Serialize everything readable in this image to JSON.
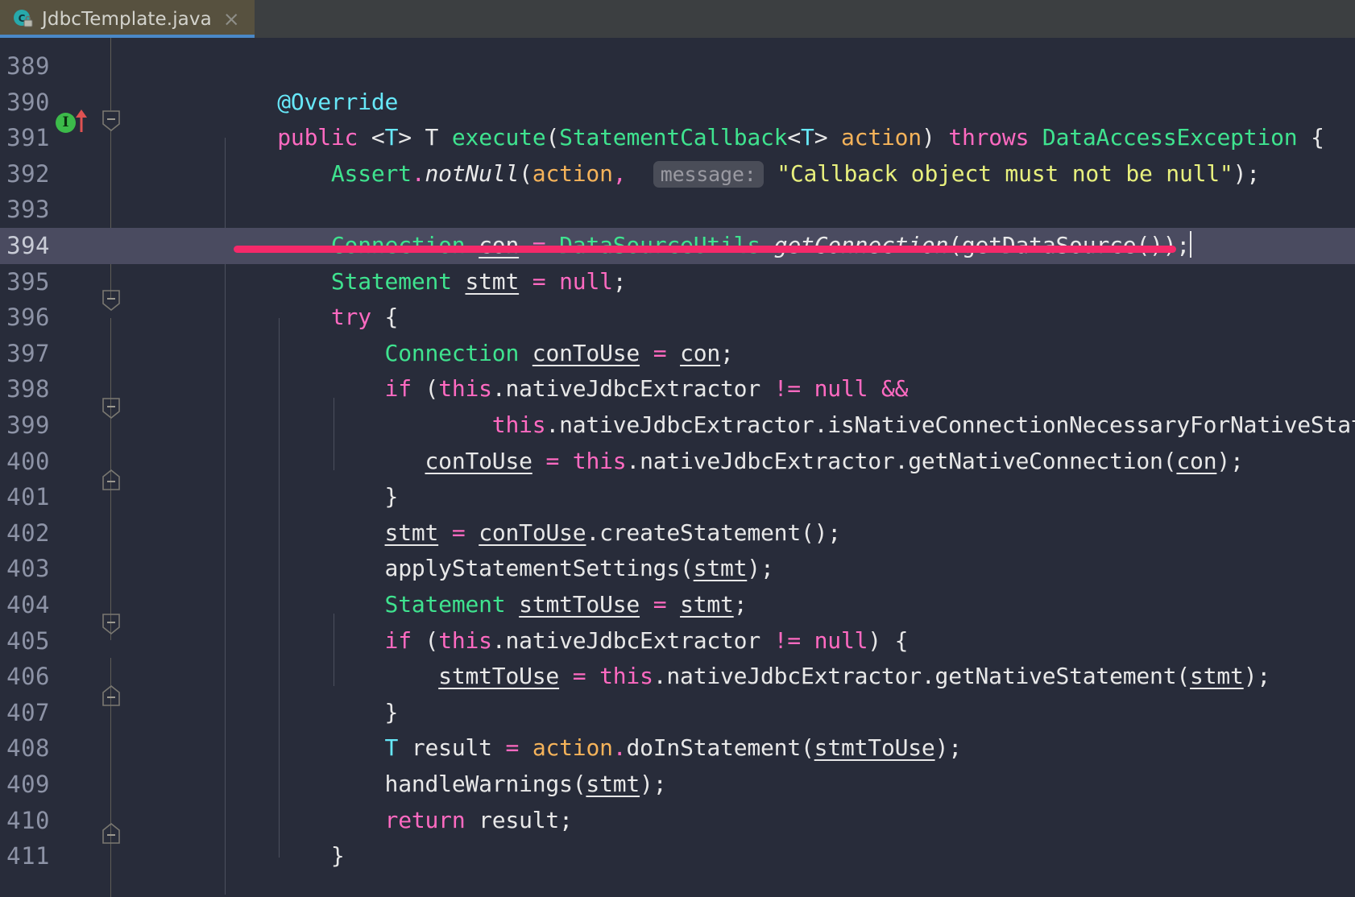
{
  "window": {
    "app": "intellij-idea-editor",
    "background": "#282c3a"
  },
  "tab": {
    "label": "JdbcTemplate.java",
    "icon": "java-class-locked-icon",
    "close_label": "×",
    "active": true,
    "accent_color": "#4a88c7",
    "tab_background": "#57513f"
  },
  "editor": {
    "first_visible_line": 389,
    "current_line": 394,
    "caret_line": 394,
    "highlight_color": "#f5296a",
    "current_line_background": "#4a4b60",
    "lines": [
      {
        "n": "389",
        "indent": 0,
        "tokens": []
      },
      {
        "n": "390",
        "indent": 0,
        "tokens": [
          {
            "t": "        ",
            "c": "plain"
          },
          {
            "t": "@Override",
            "c": "ann"
          }
        ]
      },
      {
        "n": "391",
        "indent": 0,
        "tokens": [
          {
            "t": "        ",
            "c": "plain"
          },
          {
            "t": "public",
            "c": "kw"
          },
          {
            "t": " ",
            "c": "plain"
          },
          {
            "t": "<",
            "c": "plain"
          },
          {
            "t": "T",
            "c": "gen"
          },
          {
            "t": "> T ",
            "c": "plain"
          },
          {
            "t": "execute",
            "c": "typ"
          },
          {
            "t": "(",
            "c": "plain"
          },
          {
            "t": "StatementCallback",
            "c": "typ"
          },
          {
            "t": "<",
            "c": "plain"
          },
          {
            "t": "T",
            "c": "gen"
          },
          {
            "t": "> ",
            "c": "plain"
          },
          {
            "t": "action",
            "c": "param"
          },
          {
            "t": ") ",
            "c": "plain"
          },
          {
            "t": "throws",
            "c": "kw"
          },
          {
            "t": " ",
            "c": "plain"
          },
          {
            "t": "DataAccessException",
            "c": "typ"
          },
          {
            "t": " {",
            "c": "plain"
          }
        ]
      },
      {
        "n": "392",
        "indent": 0,
        "tokens": [
          {
            "t": "            ",
            "c": "plain"
          },
          {
            "t": "Assert",
            "c": "typ"
          },
          {
            "t": ".",
            "c": "dot"
          },
          {
            "t": "notNull",
            "c": "ital"
          },
          {
            "t": "(",
            "c": "plain"
          },
          {
            "t": "action",
            "c": "param"
          },
          {
            "t": ",",
            "c": "dot"
          },
          {
            "t": "  ",
            "c": "plain"
          },
          {
            "t": "message:",
            "c": "hint"
          },
          {
            "t": " ",
            "c": "plain"
          },
          {
            "t": "\"Callback object must not be null\"",
            "c": "str"
          },
          {
            "t": ");",
            "c": "plain"
          }
        ]
      },
      {
        "n": "393",
        "indent": 0,
        "tokens": []
      },
      {
        "n": "394",
        "indent": 0,
        "tokens": [
          {
            "t": "            ",
            "c": "plain"
          },
          {
            "t": "Connection",
            "c": "typ"
          },
          {
            "t": " ",
            "c": "plain"
          },
          {
            "t": "con",
            "c": "uline"
          },
          {
            "t": " ",
            "c": "plain"
          },
          {
            "t": "=",
            "c": "dot"
          },
          {
            "t": " ",
            "c": "plain"
          },
          {
            "t": "DataSourceUtils",
            "c": "typ"
          },
          {
            "t": ".",
            "c": "dot"
          },
          {
            "t": "getConnection",
            "c": "ital"
          },
          {
            "t": "(getDataSource());",
            "c": "plain"
          }
        ]
      },
      {
        "n": "395",
        "indent": 0,
        "tokens": [
          {
            "t": "            ",
            "c": "plain"
          },
          {
            "t": "Statement",
            "c": "typ"
          },
          {
            "t": " ",
            "c": "plain"
          },
          {
            "t": "stmt",
            "c": "uline"
          },
          {
            "t": " ",
            "c": "plain"
          },
          {
            "t": "=",
            "c": "dot"
          },
          {
            "t": " ",
            "c": "plain"
          },
          {
            "t": "null",
            "c": "kw"
          },
          {
            "t": ";",
            "c": "plain"
          }
        ]
      },
      {
        "n": "396",
        "indent": 0,
        "tokens": [
          {
            "t": "            ",
            "c": "plain"
          },
          {
            "t": "try",
            "c": "kw"
          },
          {
            "t": " {",
            "c": "plain"
          }
        ]
      },
      {
        "n": "397",
        "indent": 0,
        "tokens": [
          {
            "t": "                ",
            "c": "plain"
          },
          {
            "t": "Connection",
            "c": "typ"
          },
          {
            "t": " ",
            "c": "plain"
          },
          {
            "t": "conToUse",
            "c": "uline"
          },
          {
            "t": " ",
            "c": "plain"
          },
          {
            "t": "=",
            "c": "dot"
          },
          {
            "t": " ",
            "c": "plain"
          },
          {
            "t": "con",
            "c": "uline"
          },
          {
            "t": ";",
            "c": "plain"
          }
        ]
      },
      {
        "n": "398",
        "indent": 0,
        "tokens": [
          {
            "t": "                ",
            "c": "plain"
          },
          {
            "t": "if",
            "c": "kw"
          },
          {
            "t": " (",
            "c": "plain"
          },
          {
            "t": "this",
            "c": "kw"
          },
          {
            "t": ".nativeJdbcExtractor ",
            "c": "plain"
          },
          {
            "t": "!=",
            "c": "kw"
          },
          {
            "t": " ",
            "c": "plain"
          },
          {
            "t": "null",
            "c": "kw"
          },
          {
            "t": " ",
            "c": "plain"
          },
          {
            "t": "&&",
            "c": "kw"
          }
        ]
      },
      {
        "n": "399",
        "indent": 0,
        "tokens": [
          {
            "t": "                        ",
            "c": "plain"
          },
          {
            "t": "this",
            "c": "kw"
          },
          {
            "t": ".nativeJdbcExtractor.isNativeConnectionNecessaryForNativeStat",
            "c": "plain"
          }
        ]
      },
      {
        "n": "400",
        "indent": 0,
        "tokens": [
          {
            "t": "                   ",
            "c": "plain"
          },
          {
            "t": "conToUse",
            "c": "uline"
          },
          {
            "t": " ",
            "c": "plain"
          },
          {
            "t": "=",
            "c": "dot"
          },
          {
            "t": " ",
            "c": "plain"
          },
          {
            "t": "this",
            "c": "kw"
          },
          {
            "t": ".nativeJdbcExtractor.getNativeConnection(",
            "c": "plain"
          },
          {
            "t": "con",
            "c": "uline"
          },
          {
            "t": ");",
            "c": "plain"
          }
        ]
      },
      {
        "n": "401",
        "indent": 0,
        "tokens": [
          {
            "t": "                ",
            "c": "plain"
          },
          {
            "t": "}",
            "c": "plain"
          }
        ]
      },
      {
        "n": "402",
        "indent": 0,
        "tokens": [
          {
            "t": "                ",
            "c": "plain"
          },
          {
            "t": "stmt",
            "c": "uline"
          },
          {
            "t": " ",
            "c": "plain"
          },
          {
            "t": "=",
            "c": "dot"
          },
          {
            "t": " ",
            "c": "plain"
          },
          {
            "t": "conToUse",
            "c": "uline"
          },
          {
            "t": ".createStatement();",
            "c": "plain"
          }
        ]
      },
      {
        "n": "403",
        "indent": 0,
        "tokens": [
          {
            "t": "                ",
            "c": "plain"
          },
          {
            "t": "applyStatementSettings(",
            "c": "plain"
          },
          {
            "t": "stmt",
            "c": "uline"
          },
          {
            "t": ");",
            "c": "plain"
          }
        ]
      },
      {
        "n": "404",
        "indent": 0,
        "tokens": [
          {
            "t": "                ",
            "c": "plain"
          },
          {
            "t": "Statement",
            "c": "typ"
          },
          {
            "t": " ",
            "c": "plain"
          },
          {
            "t": "stmtToUse",
            "c": "uline"
          },
          {
            "t": " ",
            "c": "plain"
          },
          {
            "t": "=",
            "c": "dot"
          },
          {
            "t": " ",
            "c": "plain"
          },
          {
            "t": "stmt",
            "c": "uline"
          },
          {
            "t": ";",
            "c": "plain"
          }
        ]
      },
      {
        "n": "405",
        "indent": 0,
        "tokens": [
          {
            "t": "                ",
            "c": "plain"
          },
          {
            "t": "if",
            "c": "kw"
          },
          {
            "t": " (",
            "c": "plain"
          },
          {
            "t": "this",
            "c": "kw"
          },
          {
            "t": ".nativeJdbcExtractor ",
            "c": "plain"
          },
          {
            "t": "!=",
            "c": "kw"
          },
          {
            "t": " ",
            "c": "plain"
          },
          {
            "t": "null",
            "c": "kw"
          },
          {
            "t": ") {",
            "c": "plain"
          }
        ]
      },
      {
        "n": "406",
        "indent": 0,
        "tokens": [
          {
            "t": "                    ",
            "c": "plain"
          },
          {
            "t": "stmtToUse",
            "c": "uline"
          },
          {
            "t": " ",
            "c": "plain"
          },
          {
            "t": "=",
            "c": "dot"
          },
          {
            "t": " ",
            "c": "plain"
          },
          {
            "t": "this",
            "c": "kw"
          },
          {
            "t": ".nativeJdbcExtractor.getNativeStatement(",
            "c": "plain"
          },
          {
            "t": "stmt",
            "c": "uline"
          },
          {
            "t": ");",
            "c": "plain"
          }
        ]
      },
      {
        "n": "407",
        "indent": 0,
        "tokens": [
          {
            "t": "                ",
            "c": "plain"
          },
          {
            "t": "}",
            "c": "plain"
          }
        ]
      },
      {
        "n": "408",
        "indent": 0,
        "tokens": [
          {
            "t": "                ",
            "c": "plain"
          },
          {
            "t": "T",
            "c": "gen"
          },
          {
            "t": " result ",
            "c": "plain"
          },
          {
            "t": "=",
            "c": "dot"
          },
          {
            "t": " ",
            "c": "plain"
          },
          {
            "t": "action",
            "c": "param"
          },
          {
            "t": ".",
            "c": "dot"
          },
          {
            "t": "doInStatement(",
            "c": "plain"
          },
          {
            "t": "stmtToUse",
            "c": "uline"
          },
          {
            "t": ");",
            "c": "plain"
          }
        ]
      },
      {
        "n": "409",
        "indent": 0,
        "tokens": [
          {
            "t": "                ",
            "c": "plain"
          },
          {
            "t": "handleWarnings(",
            "c": "plain"
          },
          {
            "t": "stmt",
            "c": "uline"
          },
          {
            "t": ");",
            "c": "plain"
          }
        ]
      },
      {
        "n": "410",
        "indent": 0,
        "tokens": [
          {
            "t": "                ",
            "c": "plain"
          },
          {
            "t": "return",
            "c": "kw"
          },
          {
            "t": " result;",
            "c": "plain"
          }
        ]
      },
      {
        "n": "411",
        "indent": 0,
        "tokens": [
          {
            "t": "            ",
            "c": "plain"
          },
          {
            "t": "}",
            "c": "plain"
          }
        ]
      }
    ],
    "gutter_markers": {
      "implementing_method_line": "391",
      "implementing_method_glyph": "I",
      "override_arrow_line": "391"
    }
  }
}
